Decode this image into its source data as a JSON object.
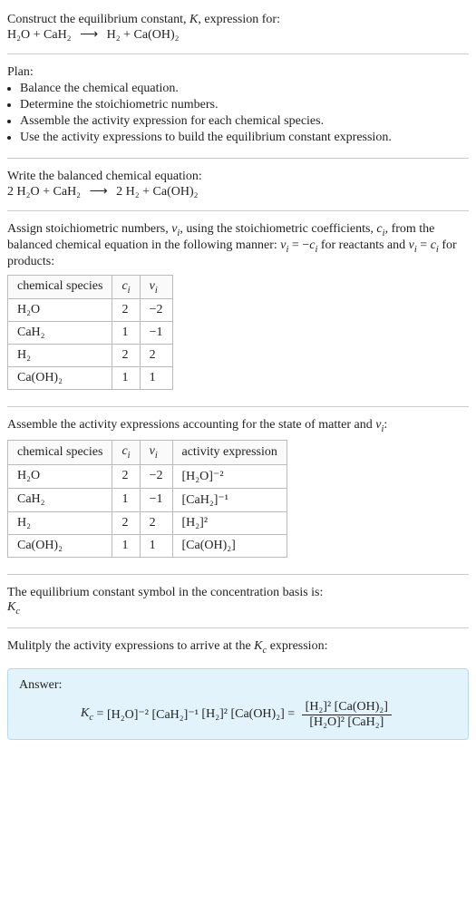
{
  "header": {
    "prompt": "Construct the equilibrium constant, K, expression for:",
    "equation_lhs1": "H₂O",
    "equation_lhs2": "CaH₂",
    "equation_rhs1": "H₂",
    "equation_rhs2": "Ca(OH)₂"
  },
  "plan": {
    "title": "Plan:",
    "items": [
      "Balance the chemical equation.",
      "Determine the stoichiometric numbers.",
      "Assemble the activity expression for each chemical species.",
      "Use the activity expressions to build the equilibrium constant expression."
    ]
  },
  "balanced": {
    "intro": "Write the balanced chemical equation:",
    "lhs1_coeff": "2",
    "lhs1": "H₂O",
    "lhs2": "CaH₂",
    "rhs1_coeff": "2",
    "rhs1": "H₂",
    "rhs2": "Ca(OH)₂"
  },
  "stoich": {
    "intro": "Assign stoichiometric numbers, νᵢ, using the stoichiometric coefficients, cᵢ, from the balanced chemical equation in the following manner: νᵢ = −cᵢ for reactants and νᵢ = cᵢ for products:",
    "headers": {
      "h1": "chemical species",
      "h2": "cᵢ",
      "h3": "νᵢ"
    },
    "rows": [
      {
        "species": "H₂O",
        "c": "2",
        "v": "−2"
      },
      {
        "species": "CaH₂",
        "c": "1",
        "v": "−1"
      },
      {
        "species": "H₂",
        "c": "2",
        "v": "2"
      },
      {
        "species": "Ca(OH)₂",
        "c": "1",
        "v": "1"
      }
    ]
  },
  "activity": {
    "intro": "Assemble the activity expressions accounting for the state of matter and νᵢ:",
    "headers": {
      "h1": "chemical species",
      "h2": "cᵢ",
      "h3": "νᵢ",
      "h4": "activity expression"
    },
    "rows": [
      {
        "species": "H₂O",
        "c": "2",
        "v": "−2",
        "expr": "[H₂O]⁻²"
      },
      {
        "species": "CaH₂",
        "c": "1",
        "v": "−1",
        "expr": "[CaH₂]⁻¹"
      },
      {
        "species": "H₂",
        "c": "2",
        "v": "2",
        "expr": "[H₂]²"
      },
      {
        "species": "Ca(OH)₂",
        "c": "1",
        "v": "1",
        "expr": "[Ca(OH)₂]"
      }
    ]
  },
  "basis": {
    "intro": "The equilibrium constant symbol in the concentration basis is:",
    "symbol": "K_c"
  },
  "multiply": {
    "intro": "Mulitply the activity expressions to arrive at the K_c expression:"
  },
  "answer": {
    "label": "Answer:",
    "kc": "K_c",
    "eq": "=",
    "t1": "[H₂O]⁻²",
    "t2": "[CaH₂]⁻¹",
    "t3": "[H₂]²",
    "t4": "[Ca(OH)₂]",
    "num": "[H₂]² [Ca(OH)₂]",
    "den": "[H₂O]² [CaH₂]"
  }
}
